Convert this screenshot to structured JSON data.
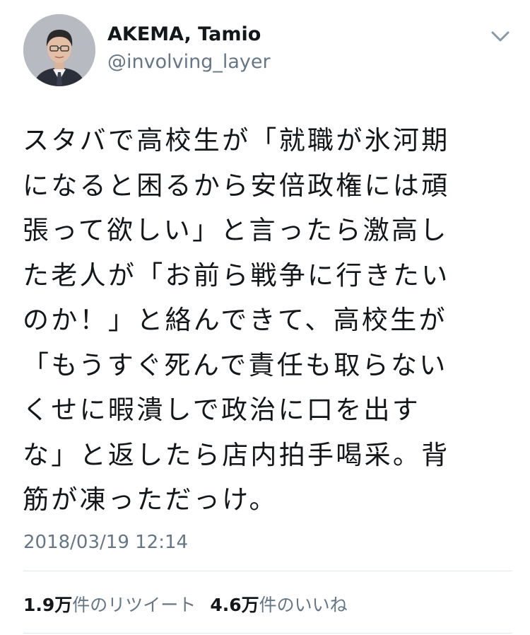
{
  "author": {
    "display_name": "AKEMA, Tamio",
    "handle": "@involving_layer",
    "avatar_icon": "profile-photo",
    "menu_icon": "chevron-down-icon"
  },
  "tweet": {
    "lines": [
      "スタバで高校生が「就職が氷河期",
      "になると困るから安倍政権には頑",
      "張って欲しい」と言ったら激高し",
      "た老人が「お前ら戦争に行きたい",
      "のか！」と絡んできて、高校生が",
      "「もうすぐ死んで責任も取らない",
      "くせに暇潰しで政治に口を出す",
      "な」と返したら店内拍手喝采。背",
      "筋が凍っただっけ。"
    ],
    "timestamp": "2018/03/19 12:14"
  },
  "stats": {
    "retweets_count": "1.9万",
    "retweets_label": "件のリツイート",
    "likes_count": "4.6万",
    "likes_label": "件のいいね"
  },
  "colors": {
    "text": "#14171a",
    "secondary": "#657786",
    "divider": "#e1e8ed"
  }
}
